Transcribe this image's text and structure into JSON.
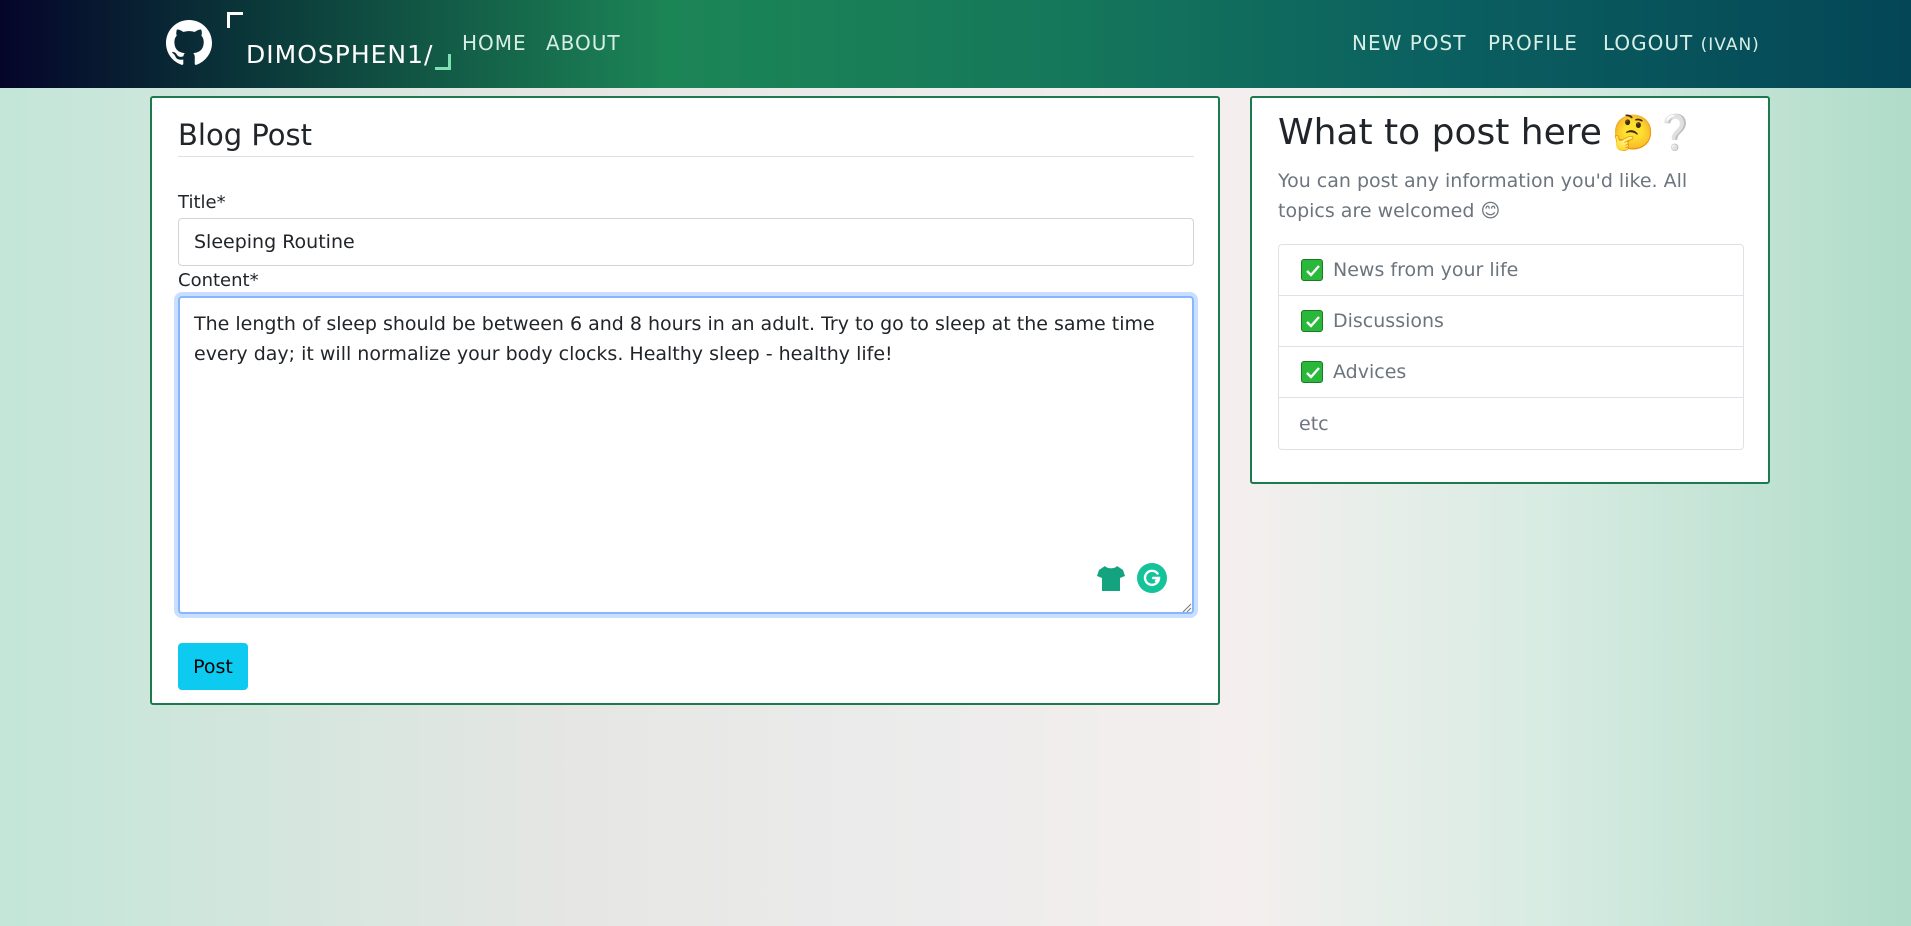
{
  "navbar": {
    "brand": "DIMOSPHEN1/",
    "links": {
      "home": "HOME",
      "about": "ABOUT",
      "new_post": "NEW POST",
      "profile": "PROFILE",
      "logout": "LOGOUT",
      "username": "(IVAN)"
    },
    "logo_icon": "github-icon"
  },
  "form": {
    "title": "Blog Post",
    "title_label": "Title*",
    "title_value": "Sleeping Routine",
    "content_label": "Content*",
    "content_value": "The length of sleep should be between 6 and 8 hours in an adult. Try to go to sleep at the same time every day; it will normalize your body clocks. Healthy sleep - healthy life!",
    "submit_label": "Post"
  },
  "sidebar": {
    "title": "What to post here",
    "title_emoji": "🤔❔",
    "description": "You can post any information you'd like. All topics are welcomed",
    "description_emoji": "😊",
    "items": [
      {
        "label": "News from your life",
        "checked": true
      },
      {
        "label": "Discussions",
        "checked": true
      },
      {
        "label": "Advices",
        "checked": true
      },
      {
        "label": "etc",
        "checked": false
      }
    ]
  },
  "colors": {
    "card_border": "#1b7a4e",
    "button_primary": "#0dcaf0",
    "check_green": "#2ab83a",
    "focus_border": "#86b7fe"
  }
}
